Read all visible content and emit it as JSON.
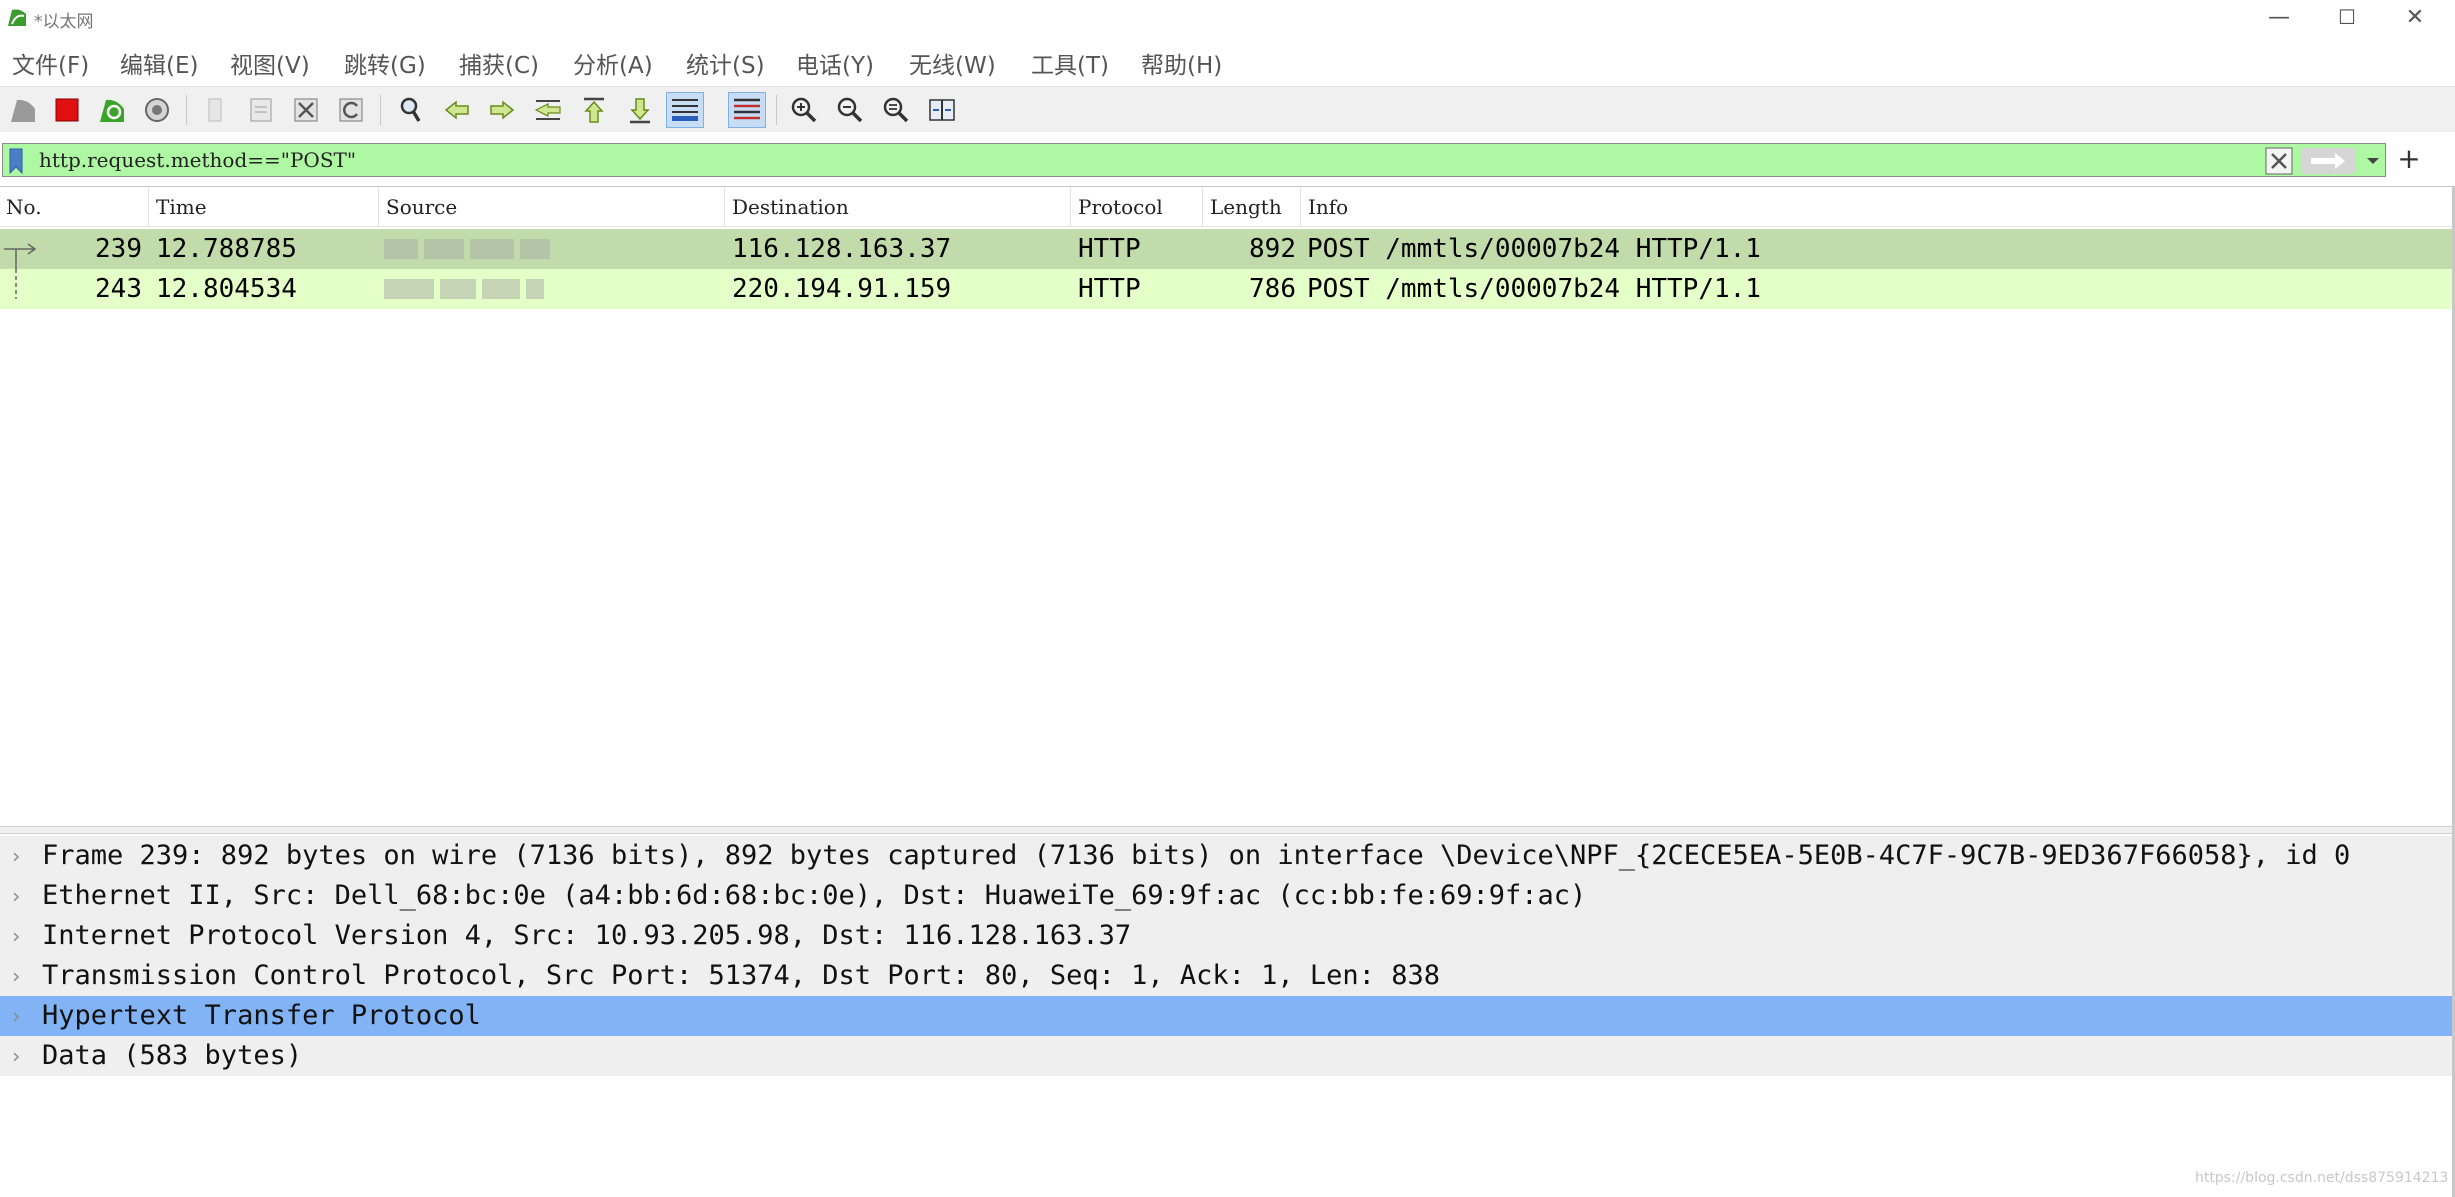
{
  "window": {
    "title": "*以太网",
    "minimize_glyph": "—",
    "maximize_glyph": "☐",
    "close_glyph": "✕"
  },
  "menu": [
    "文件(F)",
    "编辑(E)",
    "视图(V)",
    "跳转(G)",
    "捕获(C)",
    "分析(A)",
    "统计(S)",
    "电话(Y)",
    "无线(W)",
    "工具(T)",
    "帮助(H)"
  ],
  "toolbar": {
    "icons": [
      "shark-fin-start-icon",
      "stop-capture-icon",
      "restart-capture-icon",
      "capture-options-icon",
      "open-file-icon",
      "save-file-icon",
      "close-file-icon",
      "reload-file-icon",
      "find-packet-icon",
      "go-back-icon",
      "go-forward-icon",
      "go-to-packet-icon",
      "first-packet-icon",
      "last-packet-icon",
      "auto-scroll-icon",
      "colorize-icon",
      "zoom-in-icon",
      "zoom-out-icon",
      "zoom-normal-icon",
      "resize-columns-icon"
    ]
  },
  "filter": {
    "value": "http.request.method==\"POST\"",
    "background_color": "#aff8a3"
  },
  "packet_list": {
    "columns": [
      "No.",
      "Time",
      "Source",
      "Destination",
      "Protocol",
      "Length",
      "Info"
    ],
    "rows": [
      {
        "no": "239",
        "time": "12.788785",
        "source": "",
        "destination": "116.128.163.37",
        "protocol": "HTTP",
        "length": "892",
        "info": "POST /mmtls/00007b24 HTTP/1.1",
        "selected": true
      },
      {
        "no": "243",
        "time": "12.804534",
        "source": "",
        "destination": "220.194.91.159",
        "protocol": "HTTP",
        "length": "786",
        "info": "POST /mmtls/00007b24 HTTP/1.1",
        "selected": false
      }
    ],
    "selected_row_color": "#c2dbaa",
    "row_color": "#e4ffc7"
  },
  "details": {
    "expander_glyph": "›",
    "items": [
      "Frame 239: 892 bytes on wire (7136 bits), 892 bytes captured (7136 bits) on interface \\Device\\NPF_{2CECE5EA-5E0B-4C7F-9C7B-9ED367F66058}, id 0",
      "Ethernet II, Src: Dell_68:bc:0e (a4:bb:6d:68:bc:0e), Dst: HuaweiTe_69:9f:ac (cc:bb:fe:69:9f:ac)",
      "Internet Protocol Version 4, Src: 10.93.205.98, Dst: 116.128.163.37",
      "Transmission Control Protocol, Src Port: 51374, Dst Port: 80, Seq: 1, Ack: 1, Len: 838",
      "Hypertext Transfer Protocol",
      "Data (583 bytes)"
    ],
    "selected_index": 4,
    "selected_color": "#82b4f5"
  },
  "watermark": "https://blog.csdn.net/dss875914213"
}
